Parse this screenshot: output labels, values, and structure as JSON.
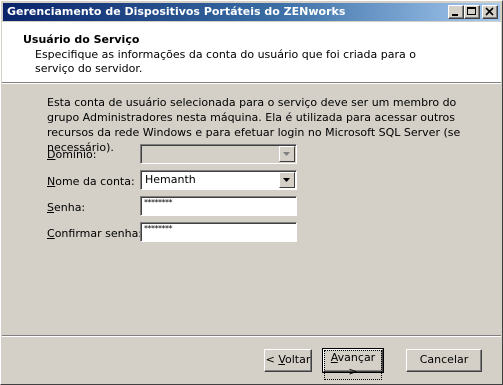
{
  "window": {
    "title": "Gerenciamento de Dispositivos Portáteis do ZENworks",
    "controls": [
      "minimize-icon",
      "maximize-icon",
      "close-icon"
    ]
  },
  "header": {
    "title": "Usuário do Serviço",
    "subtitle": "Especifique as informações da conta do usuário que foi criada para o serviço do servidor."
  },
  "description": "Esta conta de usuário selecionada para o serviço deve ser um membro do grupo Administradores nesta máquina. Ela é utilizada para acessar outros recursos da rede Windows e para efetuar login no Microsoft SQL Server (se necessário).",
  "form": {
    "domain": {
      "label_key": "D",
      "label_rest": "omínio:",
      "value": ""
    },
    "account": {
      "label_key": "N",
      "label_rest": "ome da conta:",
      "value": "Hemanth"
    },
    "password": {
      "label_key": "S",
      "label_rest": "enha:",
      "value": "********"
    },
    "confirm": {
      "label_key": "C",
      "label_rest": "onfirmar senha:",
      "value": "********"
    }
  },
  "buttons": {
    "back_lt": "< ",
    "back_key": "V",
    "back_rest": "oltar",
    "next_key": "A",
    "next_rest": "vançar >",
    "cancel": "Cancelar"
  }
}
